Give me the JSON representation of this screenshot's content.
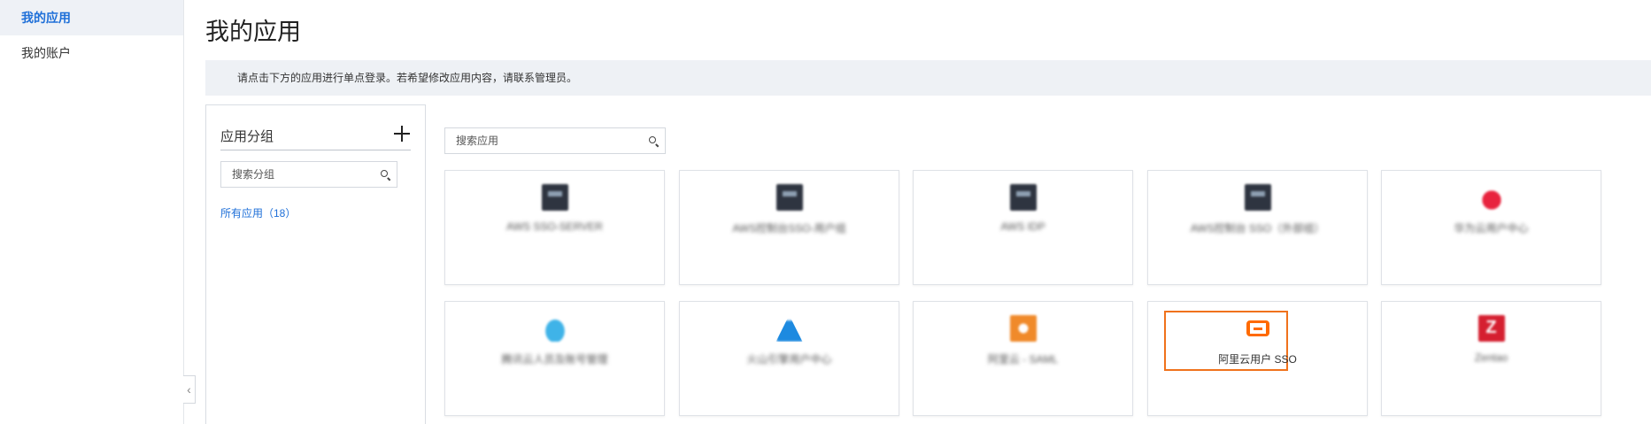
{
  "sidebar": {
    "items": [
      {
        "label": "我的应用",
        "active": true
      },
      {
        "label": "我的账户",
        "active": false
      }
    ],
    "collapse_icon": "chevron-left-icon",
    "collapse_glyph": "‹"
  },
  "main": {
    "title": "我的应用",
    "notice": "请点击下方的应用进行单点登录。若希望修改应用内容，请联系管理员。"
  },
  "groups": {
    "title": "应用分组",
    "add_icon": "plus-icon",
    "search_placeholder": "搜索分组",
    "all_label": "所有应用（18）"
  },
  "apps": {
    "search_placeholder": "搜索应用",
    "highlight_color": "#f0721c",
    "cards": [
      {
        "label": "AWS SSO-SERVER",
        "icon": "server-icon",
        "blurred": true
      },
      {
        "label": "AWS控制台SSO-用户组",
        "icon": "server-icon",
        "blurred": true
      },
      {
        "label": "AWS IDP",
        "icon": "server-icon",
        "blurred": true
      },
      {
        "label": "AWS控制台 SSO（外部组）",
        "icon": "server-icon",
        "blurred": true
      },
      {
        "label": "华为云用户中心",
        "icon": "huawei-icon",
        "blurred": true
      },
      {
        "label": "腾讯云人员及账号管理",
        "icon": "cloud-icon",
        "blurred": true
      },
      {
        "label": "火山引擎用户中心",
        "icon": "triangle-icon",
        "blurred": true
      },
      {
        "label": "阿里云 - SAML",
        "icon": "orange-circle-icon",
        "blurred": true
      },
      {
        "label": "阿里云用户 SSO",
        "icon": "aliyun-icon",
        "blurred": false
      },
      {
        "label": "Zentao",
        "icon": "zentao-icon",
        "blurred": true
      }
    ]
  }
}
